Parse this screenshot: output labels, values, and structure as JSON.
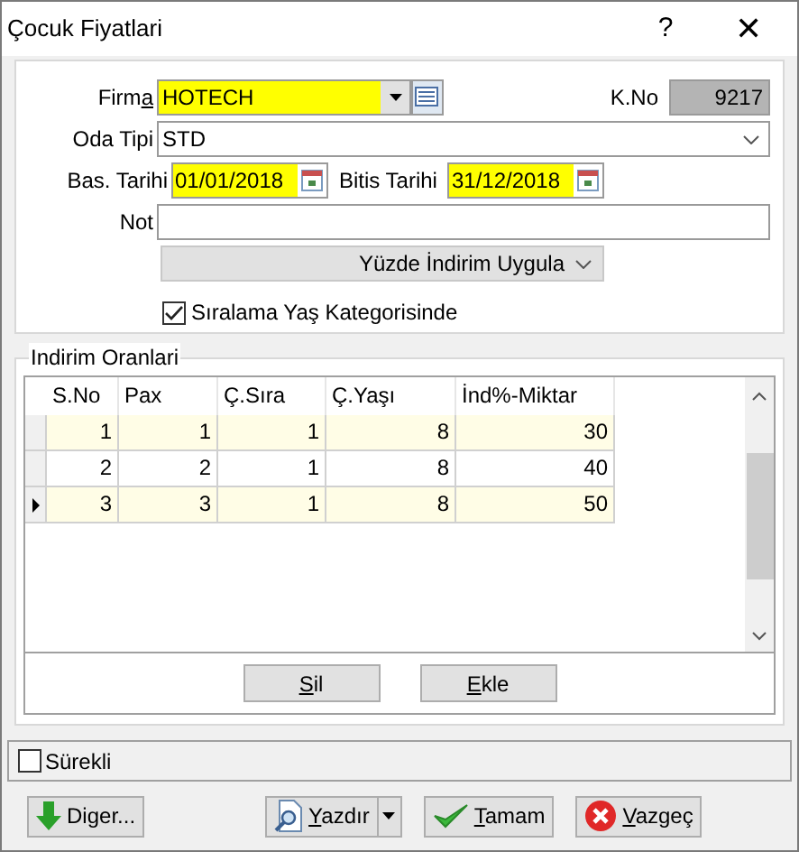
{
  "window": {
    "title": "Çocuk Fiyatlari",
    "help": "?",
    "close": "✕"
  },
  "form": {
    "firma": {
      "label": {
        "pre": "Firm",
        "accel": "a"
      },
      "value": "HOTECH"
    },
    "kno": {
      "label": "K.No",
      "value": "9217"
    },
    "oda_tipi": {
      "label": "Oda Tipi",
      "value": "STD"
    },
    "bas_tarihi": {
      "label": "Bas. Tarihi",
      "value": "01/01/2018"
    },
    "bitis_tarihi": {
      "label": "Bitis Tarihi",
      "value": "31/12/2018"
    },
    "not": {
      "label": "Not"
    },
    "mode": {
      "value": "Yüzde İndirim Uygula"
    },
    "siralama": {
      "label": "Sıralama Yaş Kategorisinde",
      "checked": true
    }
  },
  "group": {
    "title": "Indirim Oranlari",
    "columns": [
      "S.No",
      "Pax",
      "Ç.Sıra",
      "Ç.Yaşı",
      "İnd%-Miktar"
    ],
    "rows": [
      {
        "cells": [
          "1",
          "1",
          "1",
          "8",
          "30"
        ],
        "selected": false
      },
      {
        "cells": [
          "2",
          "2",
          "1",
          "8",
          "40"
        ],
        "selected": false
      },
      {
        "cells": [
          "3",
          "3",
          "1",
          "8",
          "50"
        ],
        "selected": true
      }
    ],
    "buttons": [
      {
        "label": {
          "accel": "S",
          "post": "il"
        }
      },
      {
        "label": {
          "accel": "E",
          "post": "kle"
        }
      }
    ]
  },
  "surekli": {
    "label": "Sürekli",
    "checked": false
  },
  "footer_buttons": [
    {
      "kind": "down",
      "label": {
        "pre": "Di",
        "accel": "g",
        "post": "er..."
      }
    },
    {
      "kind": "print",
      "label": {
        "accel": "Y",
        "post": "azdır"
      }
    },
    {
      "kind": "ok",
      "label": {
        "accel": "T",
        "post": "amam"
      }
    },
    {
      "kind": "cancel",
      "label": {
        "accel": "V",
        "post": "azgeç"
      }
    }
  ]
}
